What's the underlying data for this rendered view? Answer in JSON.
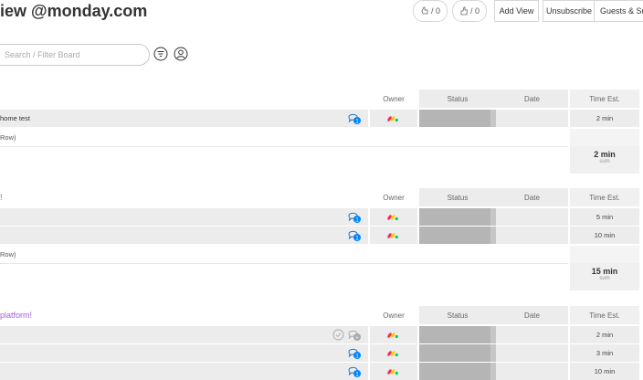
{
  "header": {
    "title": "view @monday.com",
    "likes": "/ 0",
    "reactions": "/ 0",
    "add_view": "Add View",
    "unsubscribe": "Unsubscribe",
    "guests": "Guests & Sub"
  },
  "toolbar": {
    "search_placeholder": "Search / Filter Board"
  },
  "columns": {
    "owner": "Owner",
    "status": "Status",
    "date": "Date",
    "time_est": "Time Est."
  },
  "groups": [
    {
      "title": "",
      "title_color": "#333333",
      "rows": [
        {
          "name": "home test",
          "time": "2 min"
        }
      ],
      "add_row": "Row)",
      "sum": {
        "value": "2 min",
        "label": "sum"
      }
    },
    {
      "title": "!",
      "title_color": "#3b8ad9",
      "rows": [
        {
          "name": "",
          "time": "5 min"
        },
        {
          "name": "",
          "time": "10 min"
        }
      ],
      "add_row": "Row)",
      "sum": {
        "value": "15 min",
        "label": "sum"
      }
    },
    {
      "title": "platform!",
      "title_color": "#a25ddc",
      "rows": [
        {
          "name": "",
          "time": "2 min"
        },
        {
          "name": "",
          "time": "3 min"
        },
        {
          "name": "",
          "time": "10 min"
        }
      ]
    }
  ],
  "colors": {
    "accent_blue": "#0085ff",
    "status_grey": "#b5b5b5",
    "cell_grey": "#ececec"
  }
}
